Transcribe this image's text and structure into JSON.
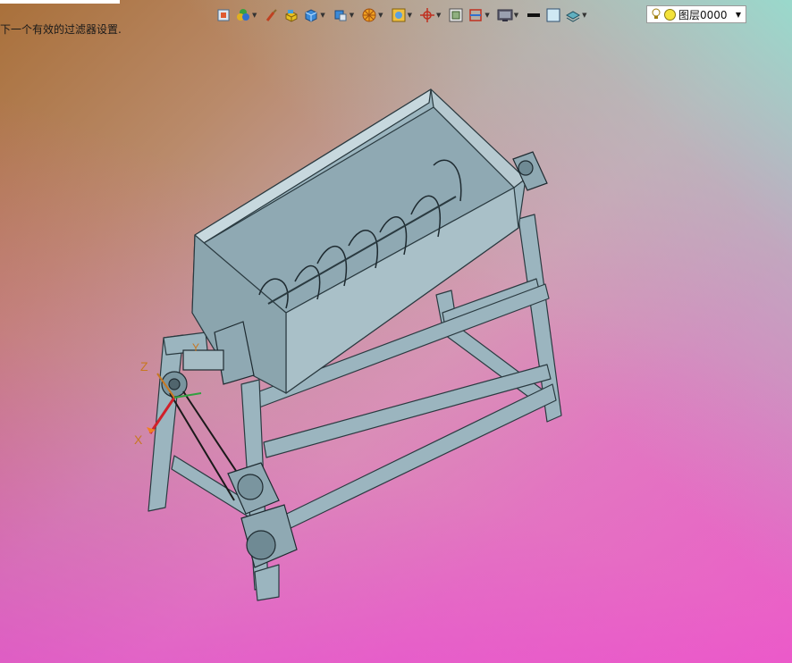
{
  "status": {
    "message": "下一个有效的过滤器设置."
  },
  "toolbar": {
    "buttons": [
      {
        "icon": "snap-view-icon",
        "dropdown": false
      },
      {
        "icon": "color-palette-icon",
        "dropdown": true
      },
      {
        "icon": "paint-brush-icon",
        "dropdown": false
      },
      {
        "icon": "yellow-block-icon",
        "dropdown": false
      },
      {
        "icon": "blue-cube-icon",
        "dropdown": true
      },
      {
        "icon": "face-color-icon",
        "dropdown": true
      },
      {
        "icon": "wheel-icon",
        "dropdown": true
      },
      {
        "icon": "render-style-icon",
        "dropdown": true
      },
      {
        "icon": "axis-cross-icon",
        "dropdown": true
      },
      {
        "icon": "frame-view-icon",
        "dropdown": false
      },
      {
        "icon": "section-view-icon",
        "dropdown": true
      },
      {
        "icon": "monitor-icon",
        "dropdown": true
      },
      {
        "icon": "line-weight-icon",
        "dropdown": false
      },
      {
        "icon": "background-color-icon",
        "dropdown": false
      },
      {
        "icon": "layers-icon",
        "dropdown": true
      }
    ]
  },
  "layer": {
    "current": "图层0000",
    "colors": {
      "light": "#f3e23a"
    }
  },
  "triad": {
    "z_label": "Z",
    "x_label": "X",
    "y_label": "Y"
  },
  "colors": {
    "model_fill": "#9bb5bf",
    "model_stroke": "#2a3a40",
    "axis_label": "#c87820"
  }
}
